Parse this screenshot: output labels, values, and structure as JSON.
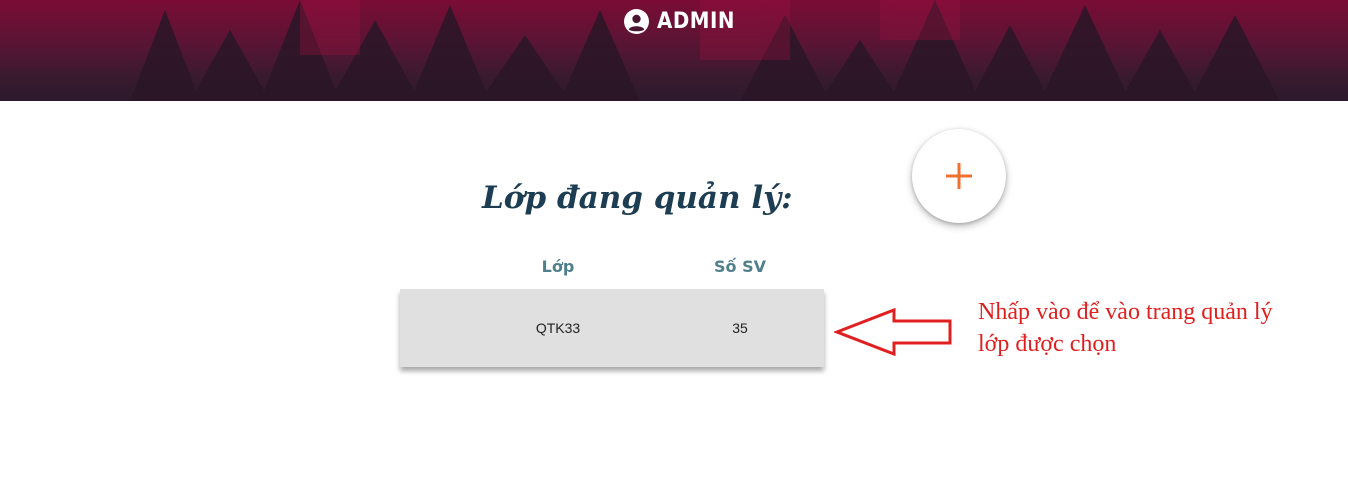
{
  "header": {
    "title": "ADMIN",
    "icon": "user-circle-icon",
    "background_colors": [
      "#7a0c35",
      "#2c1a2c"
    ]
  },
  "main": {
    "section_title": "Lớp đang quản lý:",
    "add_button": {
      "icon": "plus-icon",
      "label": "+",
      "color": "#f07030"
    },
    "table": {
      "headers": [
        "Lớp",
        "Số SV"
      ],
      "rows": [
        {
          "class": "QTK33",
          "students": "35"
        }
      ]
    }
  },
  "annotation": {
    "text_line1": "Nhấp vào để vào trang quản lý",
    "text_line2": "lớp được chọn",
    "arrow_icon": "arrow-left-icon",
    "color": "#e02020"
  }
}
